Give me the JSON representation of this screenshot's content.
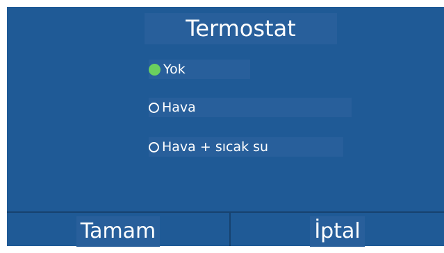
{
  "dialog": {
    "title": "Termostat",
    "options": [
      {
        "label": "Yok",
        "selected": true
      },
      {
        "label": "Hava",
        "selected": false
      },
      {
        "label": "Hava + sıcak su",
        "selected": false
      }
    ]
  },
  "buttons": {
    "ok": "Tamam",
    "cancel": "İptal"
  },
  "colors": {
    "background": "#1f5a96",
    "label_background": "#285f9b",
    "selected_radio": "#6bd05e",
    "text": "#ffffff"
  }
}
